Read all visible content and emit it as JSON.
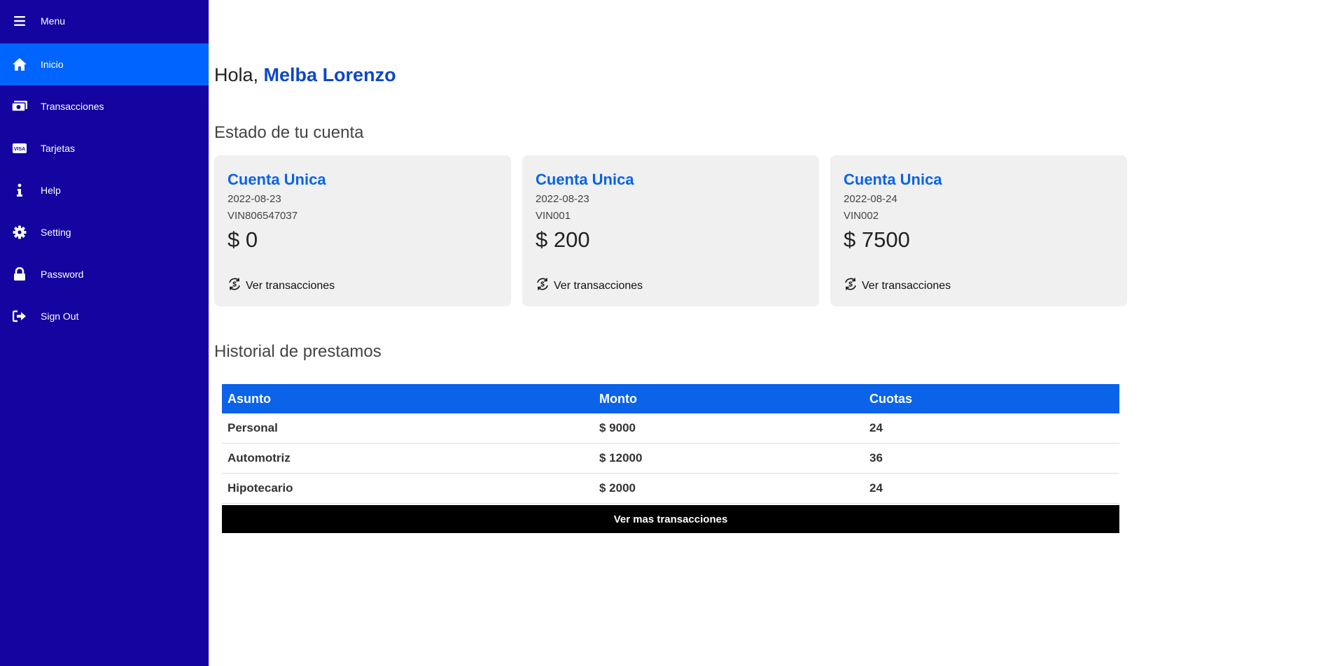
{
  "sidebar": {
    "menu_label": "Menu",
    "items": [
      {
        "label": "Inicio",
        "icon": "home-icon",
        "active": true
      },
      {
        "label": "Transacciones",
        "icon": "money-icon",
        "active": false
      },
      {
        "label": "Tarjetas",
        "icon": "visa-card-icon",
        "active": false
      },
      {
        "label": "Help",
        "icon": "info-icon",
        "active": false
      },
      {
        "label": "Setting",
        "icon": "gear-icon",
        "active": false
      },
      {
        "label": "Password",
        "icon": "lock-icon",
        "active": false
      },
      {
        "label": "Sign Out",
        "icon": "sign-out-icon",
        "active": false
      }
    ]
  },
  "greeting": {
    "prefix": "Hola,",
    "name": "Melba Lorenzo"
  },
  "accounts_section": {
    "title": "Estado de tu cuenta",
    "link_label": "Ver transacciones",
    "cards": [
      {
        "title": "Cuenta Unica",
        "date": "2022-08-23",
        "number": "VIN806547037",
        "balance": "$ 0"
      },
      {
        "title": "Cuenta Unica",
        "date": "2022-08-23",
        "number": "VIN001",
        "balance": "$ 200"
      },
      {
        "title": "Cuenta Unica",
        "date": "2022-08-24",
        "number": "VIN002",
        "balance": "$ 7500"
      }
    ]
  },
  "loans_section": {
    "title": "Historial de prestamos",
    "headers": [
      "Asunto",
      "Monto",
      "Cuotas"
    ],
    "rows": [
      [
        "Personal",
        "$ 9000",
        "24"
      ],
      [
        "Automotriz",
        "$ 12000",
        "36"
      ],
      [
        "Hipotecario",
        "$ 2000",
        "24"
      ]
    ],
    "more_button": "Ver mas transacciones"
  },
  "colors": {
    "sidebar_bg": "#1404a0",
    "sidebar_active": "#0064ff",
    "accent_blue": "#0a63e8",
    "name_blue": "#0d47c9",
    "card_bg": "#f0f0f0"
  }
}
